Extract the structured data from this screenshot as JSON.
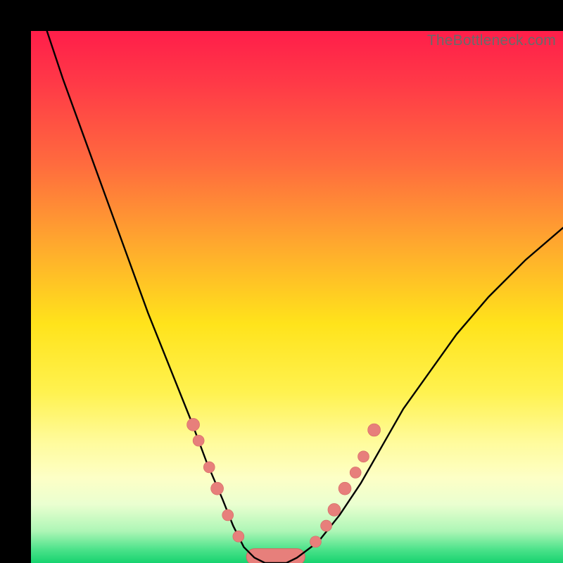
{
  "watermark": "TheBottleneck.com",
  "colors": {
    "frame": "#000000",
    "curve": "#000000",
    "marker_fill": "#e77f7b",
    "marker_stroke": "#d46863",
    "gradient_stops": [
      {
        "offset": 0.0,
        "color": "#ff1e4a"
      },
      {
        "offset": 0.1,
        "color": "#ff3a47"
      },
      {
        "offset": 0.25,
        "color": "#ff6b3e"
      },
      {
        "offset": 0.4,
        "color": "#ffa82e"
      },
      {
        "offset": 0.55,
        "color": "#ffe31b"
      },
      {
        "offset": 0.68,
        "color": "#fff250"
      },
      {
        "offset": 0.77,
        "color": "#fffb9a"
      },
      {
        "offset": 0.84,
        "color": "#fdffc6"
      },
      {
        "offset": 0.89,
        "color": "#eaffd0"
      },
      {
        "offset": 0.94,
        "color": "#aef6b6"
      },
      {
        "offset": 0.975,
        "color": "#4be28a"
      },
      {
        "offset": 1.0,
        "color": "#17d36f"
      }
    ]
  },
  "chart_data": {
    "type": "line",
    "title": "",
    "xlabel": "",
    "ylabel": "",
    "xlim": [
      0,
      100
    ],
    "ylim": [
      0,
      100
    ],
    "series": [
      {
        "name": "bottleneck-curve",
        "x": [
          3,
          6,
          10,
          14,
          18,
          22,
          26,
          30,
          33,
          36,
          38,
          40,
          42,
          44,
          46,
          48,
          50,
          54,
          58,
          62,
          66,
          70,
          75,
          80,
          86,
          93,
          100
        ],
        "y": [
          100,
          91,
          80,
          69,
          58,
          47,
          37,
          27,
          19,
          12,
          7,
          3,
          1,
          0,
          0,
          0,
          1,
          4,
          9,
          15,
          22,
          29,
          36,
          43,
          50,
          57,
          63
        ]
      }
    ],
    "markers_left": [
      {
        "x": 30.5,
        "y": 26,
        "r": 9
      },
      {
        "x": 31.5,
        "y": 23,
        "r": 8
      },
      {
        "x": 33.5,
        "y": 18,
        "r": 8
      },
      {
        "x": 35.0,
        "y": 14,
        "r": 9
      },
      {
        "x": 37.0,
        "y": 9,
        "r": 8
      },
      {
        "x": 39.0,
        "y": 5,
        "r": 8
      }
    ],
    "markers_right": [
      {
        "x": 53.5,
        "y": 4,
        "r": 8
      },
      {
        "x": 55.5,
        "y": 7,
        "r": 8
      },
      {
        "x": 57.0,
        "y": 10,
        "r": 9
      },
      {
        "x": 59.0,
        "y": 14,
        "r": 9
      },
      {
        "x": 61.0,
        "y": 17,
        "r": 8
      },
      {
        "x": 62.5,
        "y": 20,
        "r": 8
      },
      {
        "x": 64.5,
        "y": 25,
        "r": 9
      }
    ],
    "bottom_band": {
      "x_start": 40.5,
      "x_end": 51.5,
      "y": 0.5,
      "height": 2.2
    }
  }
}
